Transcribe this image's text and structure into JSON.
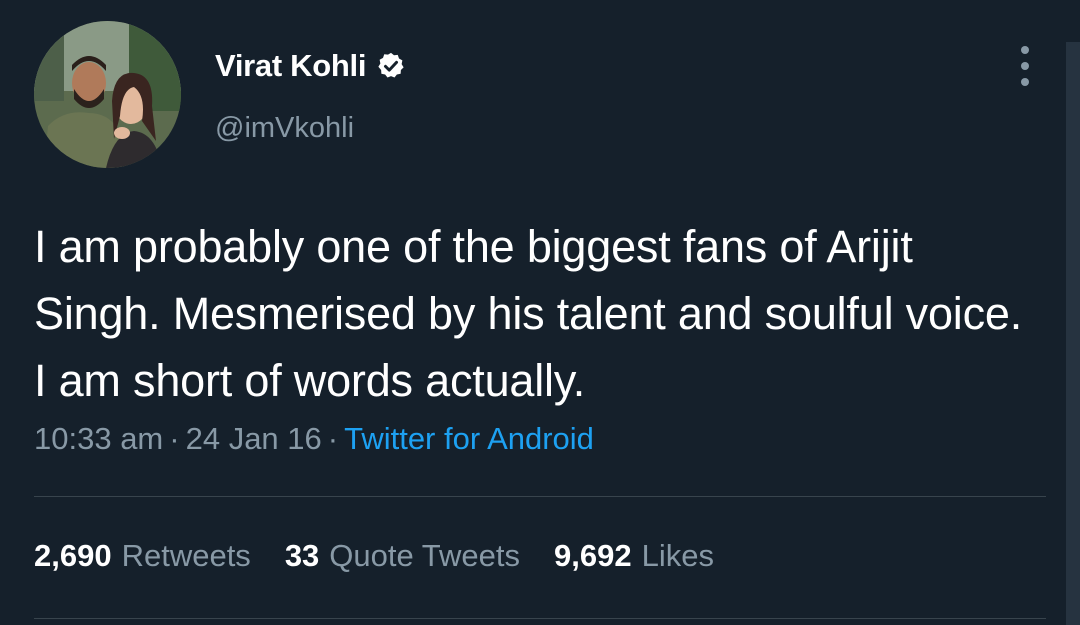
{
  "user": {
    "display_name": "Virat Kohli",
    "handle": "@imVkohli",
    "verified": true,
    "avatar": "profile-photo"
  },
  "tweet": {
    "text": "I am probably one of the biggest fans of Arijit Singh. Mesmerised by his talent and soulful voice. I am short of words actually.",
    "time": "10:33 am",
    "date": "24 Jan 16",
    "separator": "·",
    "source": "Twitter for Android"
  },
  "stats": [
    {
      "count": "2,690",
      "label": "Retweets"
    },
    {
      "count": "33",
      "label": "Quote Tweets"
    },
    {
      "count": "9,692",
      "label": "Likes"
    }
  ],
  "icons": {
    "verified": "verified-badge-icon",
    "more": "more-vertical-icon"
  },
  "colors": {
    "background": "#15202b",
    "text_primary": "#ffffff",
    "text_secondary": "#8899a6",
    "accent": "#1da1f2",
    "divider": "#38444d"
  }
}
